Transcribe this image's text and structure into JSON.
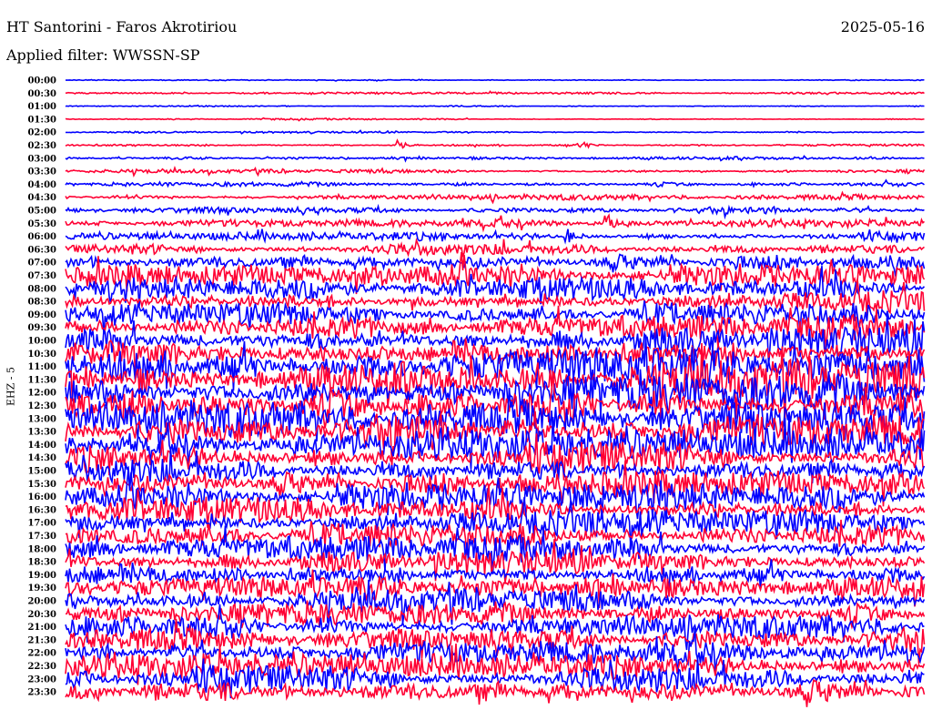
{
  "header": {
    "station": "HT Santorini - Faros Akrotiriou",
    "date": "2025-05-16",
    "filter": "Applied filter: WWSSN-SP"
  },
  "chart_data": {
    "type": "line",
    "title": "HT Santorini - Faros Akrotiriou",
    "subtitle": "Applied filter: WWSSN-SP",
    "ylabel": "EHZ - 5",
    "minutes_per_line": 30,
    "colors": [
      "#0000ff",
      "#ff0033"
    ],
    "row_labels": [
      "00:00",
      "00:30",
      "01:00",
      "01:30",
      "02:00",
      "02:30",
      "03:00",
      "03:30",
      "04:00",
      "04:30",
      "05:00",
      "05:30",
      "06:00",
      "06:30",
      "07:00",
      "07:30",
      "08:00",
      "08:30",
      "09:00",
      "09:30",
      "10:00",
      "10:30",
      "11:00",
      "11:30",
      "12:00",
      "12:30",
      "13:00",
      "13:30",
      "14:00",
      "14:30",
      "15:00",
      "15:30",
      "16:00",
      "16:30",
      "17:00",
      "17:30",
      "18:00",
      "18:30",
      "19:00",
      "19:30",
      "20:00",
      "20:30",
      "21:00",
      "21:30",
      "22:00",
      "22:30",
      "23:00",
      "23:30"
    ],
    "relative_amplitude": [
      0.3,
      0.6,
      0.4,
      0.5,
      0.6,
      0.8,
      1,
      1.2,
      1.5,
      1.8,
      2.2,
      2.5,
      2.8,
      4,
      6,
      7,
      7,
      7,
      7.5,
      8,
      11,
      12,
      13,
      13,
      13,
      13,
      12,
      12,
      11,
      10,
      9,
      8.5,
      8.5,
      8,
      8,
      8,
      8.5,
      8.5,
      8,
      7.5,
      7.5,
      7.5,
      8,
      8,
      8,
      8.5,
      8.5,
      9
    ],
    "events": [
      {
        "line": "02:30",
        "minute": 11.6,
        "amplitude": 6
      },
      {
        "line": "02:30",
        "minute": 18.0,
        "amplitude": 5
      },
      {
        "line": "05:30",
        "minute": 18.9,
        "amplitude": 10
      },
      {
        "line": "06:00",
        "minute": 17.5,
        "amplitude": 8
      }
    ]
  }
}
